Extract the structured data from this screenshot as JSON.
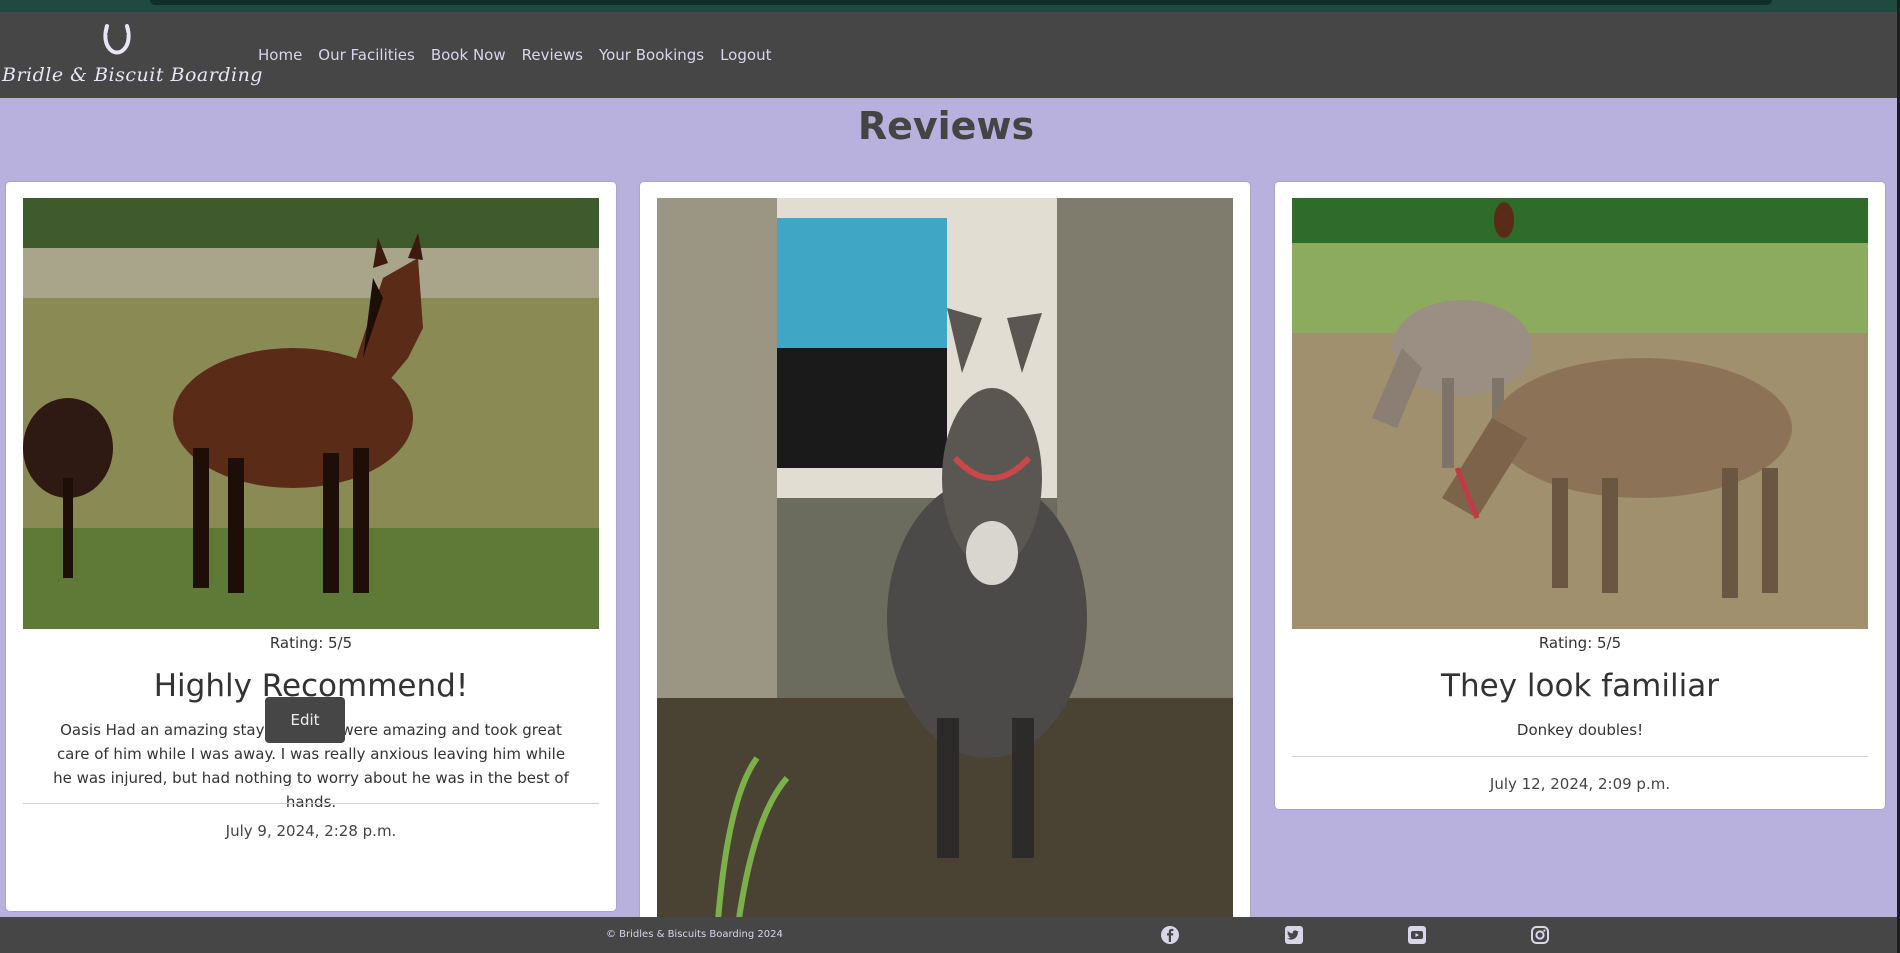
{
  "brand": {
    "name": "Bridle & Biscuit Boarding",
    "logo_icon": "horseshoe-icon"
  },
  "nav": {
    "items": [
      {
        "label": "Home"
      },
      {
        "label": "Our Facilities"
      },
      {
        "label": "Book Now"
      },
      {
        "label": "Reviews"
      },
      {
        "label": "Your Bookings"
      },
      {
        "label": "Logout"
      }
    ]
  },
  "page": {
    "title": "Reviews"
  },
  "reviews": [
    {
      "rating": "Rating: 5/5",
      "title": "Highly Recommend!",
      "text": "Oasis Had an amazing stay, the staff were amazing and took great care of him while I was away. I was really anxious leaving him while he was injured, but had nothing to worry about he was in the best of hands.",
      "date": "July 9, 2024, 2:28 p.m.",
      "edit_label": "Edit"
    },
    {
      "rating": "",
      "title": "",
      "text": "",
      "date": ""
    },
    {
      "rating": "Rating: 5/5",
      "title": "They look familiar",
      "text": "Donkey doubles!",
      "date": "July 12, 2024, 2:09 p.m."
    }
  ],
  "footer": {
    "copyright": "© Bridles & Biscuits Boarding 2024",
    "social": [
      "facebook-icon",
      "twitter-icon",
      "youtube-icon",
      "instagram-icon"
    ]
  },
  "colors": {
    "page_bg": "#b9b1dd",
    "nav_bg": "#464646",
    "top_strip": "#1f4a3f"
  }
}
